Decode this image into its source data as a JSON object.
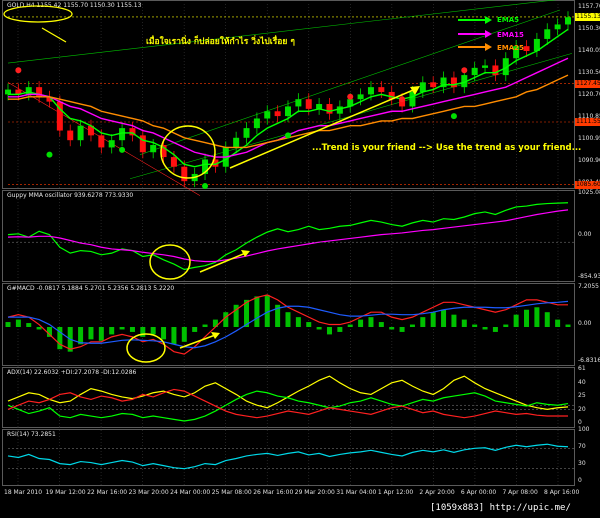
{
  "chart_data": [
    {
      "type": "line",
      "panel": "price",
      "header": "GOLD,H4 1155.42 1155.70 1150.30 1155.13",
      "ylim": [
        1085,
        1158
      ],
      "yticks": [
        "1157.70",
        "1150.30",
        "1140.05",
        "1130.50",
        "1120.70",
        "1110.85",
        "1100.95",
        "1090.90",
        "1081.45"
      ],
      "price_markers": [
        {
          "label": "1155.13",
          "color": "#ffff00"
        },
        {
          "label": "1127.45",
          "color": "#ff3a00"
        },
        {
          "label": "1111.55",
          "color": "#ff3a00"
        },
        {
          "label": "1085.60",
          "color": "#ff3a00"
        }
      ],
      "annotation_thai": "เมื่อใจเรานิ่ง ก็ปล่อยให้กำไร วิ่งไปเรื่อย ๆ",
      "annotation_trend": "...Trend is your friend --> Use the trend as your friend...",
      "close": [
        1125,
        1123,
        1126,
        1122,
        1120,
        1108,
        1104,
        1110,
        1106,
        1101,
        1104,
        1109,
        1106,
        1099,
        1102,
        1097,
        1093,
        1087,
        1090,
        1096,
        1093,
        1101,
        1105,
        1109,
        1113,
        1116,
        1114,
        1118,
        1121,
        1117,
        1119,
        1115,
        1118,
        1121,
        1123,
        1126,
        1124,
        1121,
        1118,
        1124,
        1128,
        1126,
        1130,
        1126,
        1131,
        1134,
        1135,
        1131,
        1138,
        1143,
        1141,
        1146,
        1150,
        1152,
        1155
      ],
      "series": [
        {
          "name": "EMA5",
          "color": "#00ff00",
          "values": [
            1123,
            1123,
            1124,
            1123,
            1122,
            1117,
            1113,
            1112,
            1110,
            1107,
            1106,
            1107,
            1107,
            1104,
            1103,
            1101,
            1098,
            1094,
            1093,
            1094,
            1094,
            1096,
            1099,
            1102,
            1106,
            1109,
            1111,
            1113,
            1116,
            1116,
            1117,
            1116,
            1117,
            1118,
            1120,
            1122,
            1123,
            1122,
            1121,
            1122,
            1124,
            1125,
            1127,
            1127,
            1128,
            1130,
            1132,
            1132,
            1134,
            1137,
            1139,
            1141,
            1144,
            1147,
            1150
          ]
        },
        {
          "name": "EMA15",
          "color": "#ff00ff",
          "values": [
            1122,
            1122,
            1123,
            1123,
            1122,
            1120,
            1118,
            1117,
            1115,
            1113,
            1112,
            1111,
            1110,
            1108,
            1107,
            1105,
            1103,
            1101,
            1099,
            1098,
            1097,
            1097,
            1098,
            1099,
            1101,
            1103,
            1104,
            1106,
            1108,
            1109,
            1110,
            1110,
            1111,
            1112,
            1113,
            1114,
            1115,
            1116,
            1116,
            1117,
            1118,
            1119,
            1120,
            1121,
            1122,
            1123,
            1124,
            1125,
            1126,
            1128,
            1130,
            1132,
            1134,
            1136,
            1138
          ]
        },
        {
          "name": "EMA25",
          "color": "#ff8c00",
          "values": [
            1121,
            1121,
            1122,
            1122,
            1122,
            1121,
            1120,
            1119,
            1118,
            1116,
            1115,
            1114,
            1113,
            1112,
            1110,
            1109,
            1107,
            1105,
            1104,
            1103,
            1102,
            1101,
            1101,
            1101,
            1102,
            1103,
            1104,
            1105,
            1106,
            1107,
            1108,
            1108,
            1109,
            1110,
            1110,
            1111,
            1112,
            1112,
            1113,
            1113,
            1114,
            1115,
            1116,
            1117,
            1118,
            1118,
            1119,
            1120,
            1121,
            1122,
            1124,
            1125,
            1127,
            1129,
            1131
          ]
        }
      ]
    },
    {
      "type": "line",
      "panel": "guppy",
      "header": "Guppy MMA oscillator 939.6278 773.9330",
      "yticks": [
        "1025.08",
        "0.00",
        "-854.937"
      ],
      "ylim": [
        -900,
        1100
      ],
      "series": [
        {
          "name": "",
          "color": "#00ff00",
          "values": [
            180,
            200,
            120,
            260,
            180,
            -120,
            -260,
            -200,
            -220,
            -300,
            -260,
            -160,
            -200,
            -340,
            -300,
            -420,
            -520,
            -650,
            -600,
            -560,
            -480,
            -300,
            -180,
            -20,
            120,
            240,
            320,
            250,
            300,
            380,
            300,
            330,
            380,
            400,
            460,
            520,
            480,
            420,
            380,
            460,
            520,
            480,
            560,
            540,
            600,
            680,
            720,
            660,
            760,
            840,
            860,
            900,
            920,
            930,
            940
          ]
        },
        {
          "name": "",
          "color": "#ff00ff",
          "values": [
            120,
            130,
            120,
            140,
            140,
            100,
            40,
            -20,
            -60,
            -120,
            -160,
            -180,
            -200,
            -240,
            -270,
            -300,
            -340,
            -400,
            -440,
            -460,
            -460,
            -420,
            -380,
            -330,
            -270,
            -210,
            -160,
            -120,
            -80,
            -40,
            0,
            30,
            60,
            90,
            120,
            150,
            180,
            200,
            220,
            250,
            280,
            300,
            330,
            360,
            390,
            420,
            450,
            480,
            510,
            560,
            610,
            660,
            700,
            740,
            770
          ]
        }
      ]
    },
    {
      "type": "bar",
      "panel": "macd",
      "header": "G#MACD -0.0817 5.1884 5.2701 5.2356 5.2813 5.2220",
      "yticks": [
        "7.2055",
        "0.00",
        "-6.8316"
      ],
      "ylim": [
        -7.5,
        7.5
      ],
      "histogram": [
        1.0,
        1.5,
        0.8,
        -0.5,
        -2.0,
        -4.5,
        -5.0,
        -3.5,
        -2.5,
        -2.8,
        -1.5,
        -0.5,
        -1.0,
        -2.0,
        -1.5,
        -2.5,
        -3.5,
        -3.0,
        -1.0,
        0.5,
        1.5,
        3.0,
        4.5,
        5.5,
        6.2,
        6.5,
        4.5,
        3.0,
        2.0,
        1.0,
        -0.5,
        -1.5,
        -1.0,
        0.5,
        1.5,
        2.0,
        1.0,
        -0.5,
        -1.0,
        0.5,
        2.0,
        3.0,
        3.5,
        2.5,
        1.5,
        0.5,
        -0.5,
        -1.0,
        0.5,
        2.5,
        3.5,
        4.0,
        3.0,
        1.5,
        0.5
      ],
      "series": [
        {
          "name": "",
          "color": "#ff2020",
          "values": [
            2,
            2.5,
            2,
            0.5,
            -1.5,
            -3.5,
            -4.5,
            -4,
            -3,
            -3,
            -2,
            -1.5,
            -2,
            -3,
            -2.5,
            -3.5,
            -5,
            -5.5,
            -4,
            -2,
            0,
            2,
            3.5,
            5,
            6,
            6.5,
            5.5,
            4,
            3,
            2,
            1,
            0.5,
            0.5,
            1,
            2,
            3,
            3,
            2,
            1.5,
            2,
            3,
            4,
            5,
            5,
            4.5,
            4,
            3.5,
            3,
            3.5,
            4.5,
            5.5,
            5.5,
            5,
            4.5,
            4.5
          ]
        },
        {
          "name": "",
          "color": "#1e5cff",
          "values": [
            2,
            2,
            2,
            1.5,
            0.5,
            -1,
            -2.5,
            -3.2,
            -3.3,
            -3.3,
            -3,
            -2.7,
            -2.6,
            -2.7,
            -2.8,
            -3,
            -3.5,
            -4,
            -4.2,
            -3.8,
            -3,
            -2,
            -0.8,
            0.5,
            1.8,
            3,
            3.8,
            4.2,
            4.2,
            4,
            3.5,
            3,
            2.5,
            2.2,
            2.2,
            2.4,
            2.6,
            2.6,
            2.5,
            2.5,
            2.7,
            3,
            3.5,
            3.8,
            4,
            4,
            4,
            3.9,
            3.9,
            4.1,
            4.4,
            4.7,
            4.9,
            5,
            5.2
          ]
        }
      ]
    },
    {
      "type": "line",
      "panel": "adx",
      "header": "ADX(14) 22.6032 +DI:27.2078 -DI:12.0286",
      "yticks": [
        "61",
        "40",
        "25",
        "20",
        "0"
      ],
      "ylim": [
        0,
        65
      ],
      "series": [
        {
          "name": "",
          "color": "#ffff00",
          "values": [
            30,
            35,
            40,
            38,
            32,
            28,
            30,
            38,
            45,
            42,
            38,
            35,
            33,
            36,
            40,
            42,
            38,
            35,
            40,
            48,
            52,
            45,
            38,
            30,
            25,
            22,
            28,
            35,
            42,
            48,
            55,
            60,
            52,
            45,
            40,
            38,
            45,
            52,
            55,
            48,
            42,
            38,
            45,
            55,
            60,
            52,
            45,
            40,
            35,
            30,
            25,
            22,
            20,
            22,
            23
          ]
        },
        {
          "name": "",
          "color": "#00ff00",
          "values": [
            25,
            20,
            15,
            18,
            22,
            12,
            10,
            14,
            12,
            10,
            12,
            15,
            14,
            10,
            12,
            10,
            8,
            6,
            8,
            12,
            18,
            25,
            32,
            38,
            42,
            40,
            36,
            34,
            30,
            28,
            25,
            22,
            24,
            28,
            30,
            34,
            30,
            26,
            24,
            28,
            32,
            30,
            34,
            36,
            38,
            40,
            36,
            30,
            28,
            26,
            24,
            28,
            26,
            25,
            27
          ]
        },
        {
          "name": "",
          "color": "#ff2020",
          "values": [
            20,
            25,
            30,
            28,
            32,
            38,
            40,
            35,
            32,
            36,
            34,
            30,
            32,
            38,
            35,
            40,
            44,
            42,
            36,
            30,
            24,
            18,
            14,
            12,
            10,
            12,
            15,
            18,
            16,
            14,
            18,
            22,
            20,
            18,
            16,
            14,
            18,
            22,
            24,
            20,
            16,
            18,
            14,
            12,
            10,
            12,
            15,
            18,
            16,
            14,
            15,
            13,
            12,
            12,
            12
          ]
        }
      ]
    },
    {
      "type": "line",
      "panel": "rsi",
      "header": "RSI(14) 73.2851",
      "yticks": [
        "100",
        "70",
        "30",
        "0"
      ],
      "ylim": [
        0,
        100
      ],
      "series": [
        {
          "name": "",
          "color": "#00d8e8",
          "values": [
            55,
            52,
            58,
            50,
            48,
            40,
            38,
            44,
            42,
            38,
            42,
            46,
            43,
            36,
            40,
            36,
            32,
            30,
            34,
            40,
            38,
            46,
            50,
            55,
            58,
            60,
            56,
            60,
            63,
            57,
            60,
            54,
            58,
            61,
            63,
            66,
            62,
            58,
            55,
            62,
            66,
            63,
            67,
            62,
            67,
            70,
            71,
            66,
            72,
            76,
            73,
            76,
            78,
            74,
            73
          ]
        }
      ]
    }
  ],
  "xaxis": {
    "labels": [
      "18 Mar 2010",
      "19 Mar 12:00",
      "22 Mar 16:00",
      "23 Mar 20:00",
      "24 Mar 00:00",
      "25 Mar 08:00",
      "26 Mar 16:00",
      "29 Mar 20:00",
      "31 Mar 04:00",
      "1 Apr 12:00",
      "2 Apr 20:00",
      "6 Apr 00:00",
      "7 Apr 08:00",
      "8 Apr 16:00"
    ]
  },
  "footer": "[1059x883] http://upic.me/",
  "colors": {
    "bull": "#00e000",
    "bear": "#ff1010",
    "grid": "#3a3a3a",
    "ellipse": "#ffff00",
    "channel": "#00c000",
    "annotation": "#ffff00"
  }
}
